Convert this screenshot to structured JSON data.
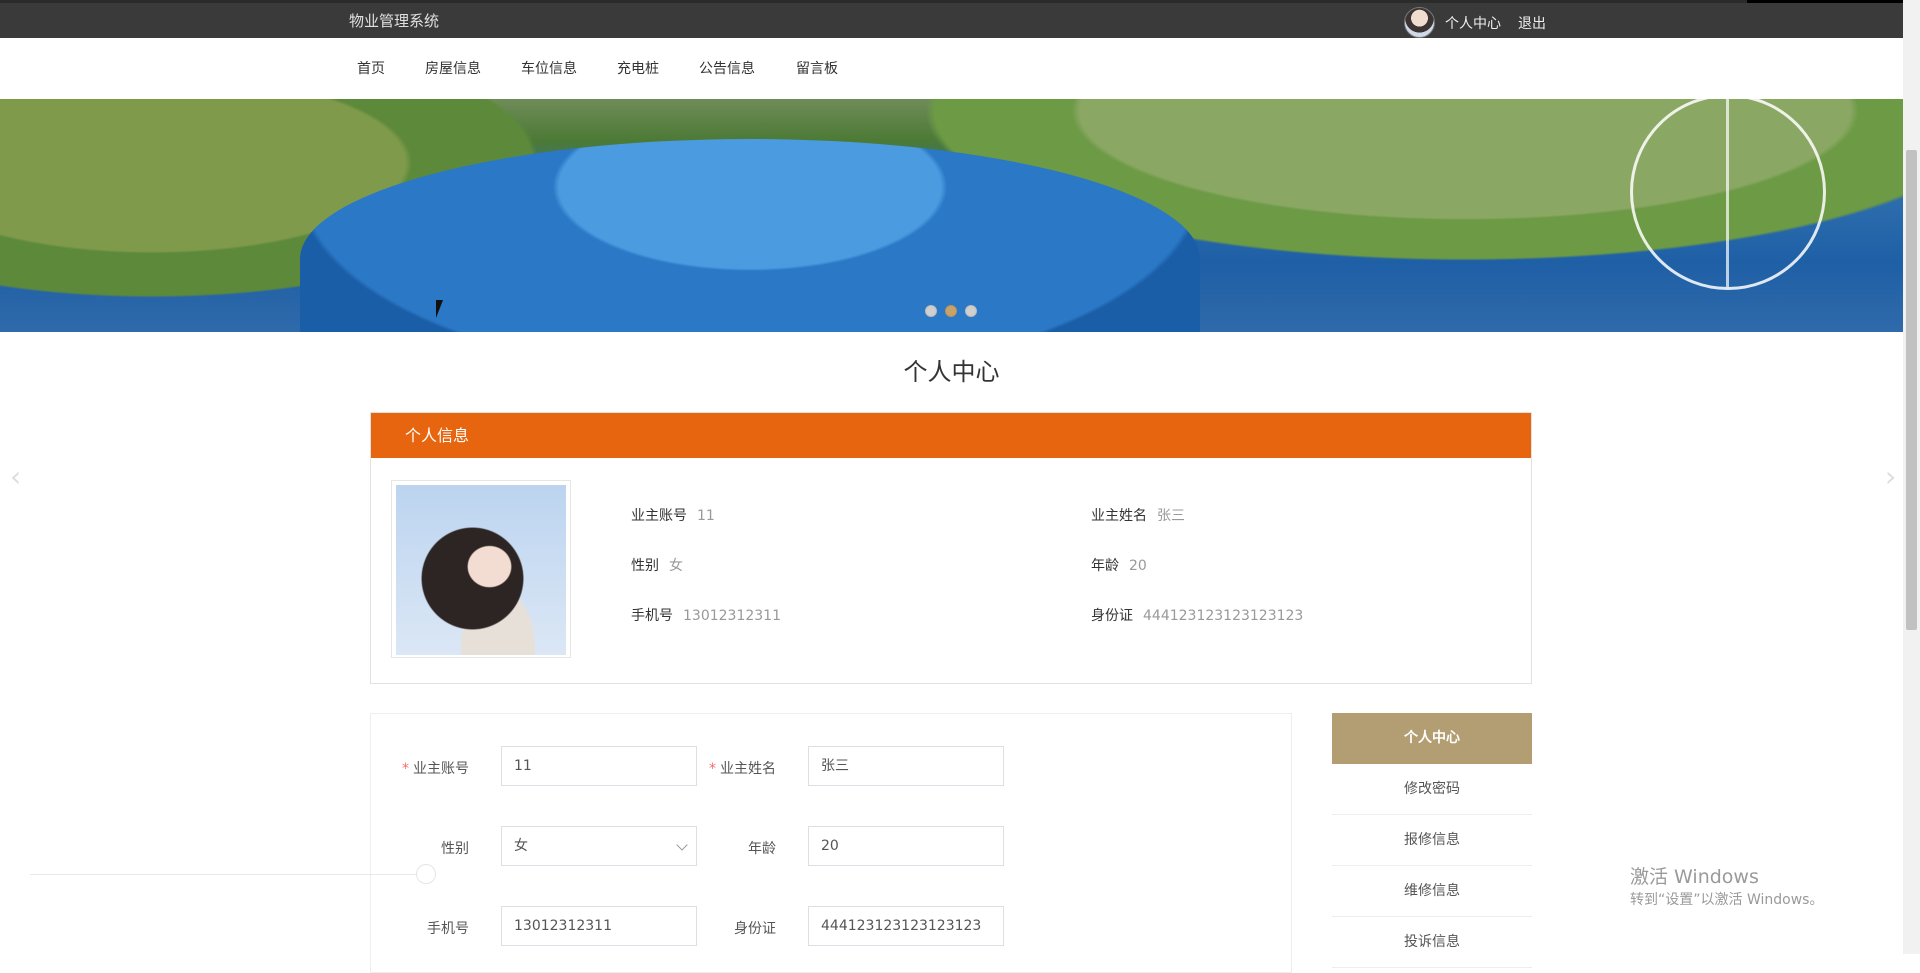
{
  "topbar": {
    "system_title": "物业管理系统",
    "user_center": "个人中心",
    "logout": "退出"
  },
  "nav": {
    "items": [
      "首页",
      "房屋信息",
      "车位信息",
      "充电桩",
      "公告信息",
      "留言板"
    ]
  },
  "banner": {
    "slide_count": 3,
    "active_slide": 2
  },
  "page": {
    "title": "个人中心"
  },
  "info": {
    "header": "个人信息",
    "account_label": "业主账号",
    "account_value": "11",
    "name_label": "业主姓名",
    "name_value": "张三",
    "gender_label": "性别",
    "gender_value": "女",
    "age_label": "年龄",
    "age_value": "20",
    "phone_label": "手机号",
    "phone_value": "13012312311",
    "id_label": "身份证",
    "id_value": "444123123123123123"
  },
  "form": {
    "required_mark": "*",
    "account_label": "业主账号",
    "account_value": "11",
    "name_label": "业主姓名",
    "name_value": "张三",
    "gender_label": "性别",
    "gender_value": "女",
    "age_label": "年龄",
    "age_value": "20",
    "phone_label": "手机号",
    "phone_value": "13012312311",
    "id_label": "身份证",
    "id_value": "444123123123123123"
  },
  "side_menu": {
    "items": [
      "个人中心",
      "修改密码",
      "报修信息",
      "维修信息",
      "投诉信息"
    ],
    "active_index": 0
  },
  "watermark": {
    "line1": "激活 Windows",
    "line2": "转到“设置”以激活 Windows。"
  },
  "colors": {
    "topbar": "#3a3a3a",
    "info_header": "#e8650f",
    "side_active": "#b39e74",
    "dot_active": "#c7a36a"
  }
}
